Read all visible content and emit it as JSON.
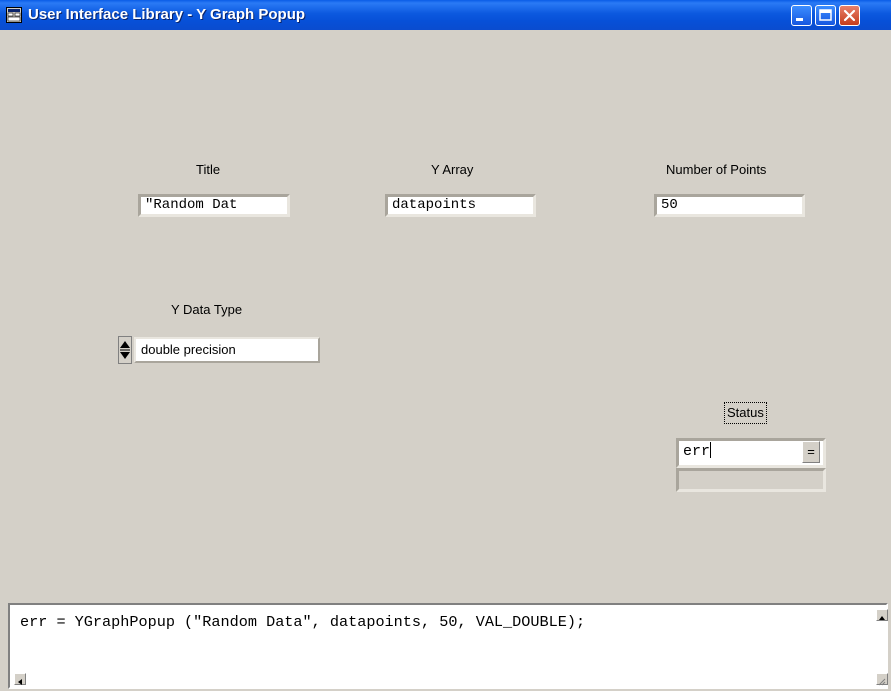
{
  "window": {
    "title": "User Interface Library - Y Graph Popup",
    "controls": {
      "minimize": "minimize",
      "maximize": "maximize",
      "close": "close"
    }
  },
  "fields": {
    "title": {
      "label": "Title",
      "value": "\"Random Dat"
    },
    "y_array": {
      "label": "Y Array",
      "value": "datapoints"
    },
    "num_points": {
      "label": "Number of Points",
      "value": "50"
    },
    "y_data_type": {
      "label": "Y Data Type",
      "value": "double precision"
    },
    "status": {
      "label": "Status",
      "value": "err",
      "menu_glyph": "="
    }
  },
  "code": {
    "line": "err = YGraphPopup (\"Random Data\", datapoints, 50, VAL_DOUBLE);"
  },
  "icons": {
    "app": "app-window-icon",
    "spin": "spin-updown-icon"
  },
  "colors": {
    "titlebar": "#0a5ce6",
    "dialog_bg": "#d4d0c8",
    "close_button": "#c53d1c"
  }
}
